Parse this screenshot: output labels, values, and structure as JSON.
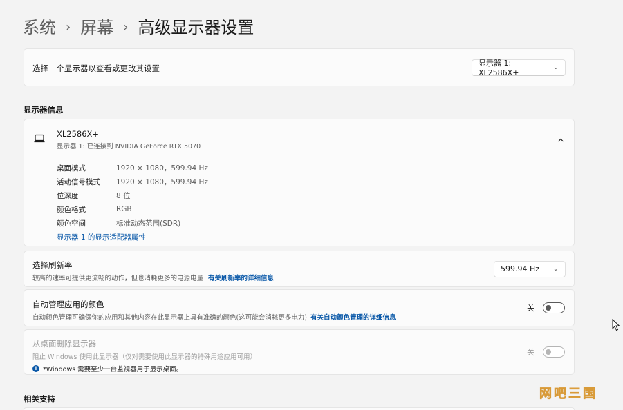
{
  "breadcrumb": {
    "items": [
      "系统",
      "屏幕"
    ],
    "separator": "›",
    "current": "高级显示器设置"
  },
  "select_display": {
    "label": "选择一个显示器以查看或更改其设置",
    "selected": "显示器 1: XL2586X+"
  },
  "display_info": {
    "section_label": "显示器信息",
    "monitor_name": "XL2586X+",
    "monitor_desc": "显示器 1: 已连接到 NVIDIA GeForce RTX 5070",
    "rows": [
      {
        "key": "桌面模式",
        "value": "1920 × 1080，599.94 Hz"
      },
      {
        "key": "活动信号模式",
        "value": "1920 × 1080，599.94 Hz"
      },
      {
        "key": "位深度",
        "value": "8 位"
      },
      {
        "key": "颜色格式",
        "value": "RGB"
      },
      {
        "key": "颜色空间",
        "value": "标准动态范围(SDR)"
      }
    ],
    "adapter_link": "显示器 1 的显示适配器属性"
  },
  "refresh_rate": {
    "title": "选择刷新率",
    "desc": "较高的速率可提供更流畅的动作，但也消耗更多的电源电量",
    "link": "有关刷新率的详细信息",
    "selected": "599.94 Hz"
  },
  "auto_color": {
    "title": "自动管理应用的颜色",
    "desc": "自动颜色管理可确保你的应用和其他内容在此显示器上具有准确的颜色(这可能会消耗更多电力)",
    "link": "有关自动颜色管理的详细信息",
    "toggle_label": "关"
  },
  "remove_display": {
    "title": "从桌面删除显示器",
    "desc": "阻止 Windows 使用此显示器（仅对需要使用此显示器的特殊用途应用可用）",
    "note": "*Windows 需要至少一台监视器用于显示桌面。",
    "toggle_label": "关"
  },
  "related_support": {
    "label": "相关支持"
  },
  "watermark": "网吧三国",
  "colors": {
    "accent": "#0a58a8",
    "background": "#f3f3f3",
    "card": "#fbfbfb"
  }
}
